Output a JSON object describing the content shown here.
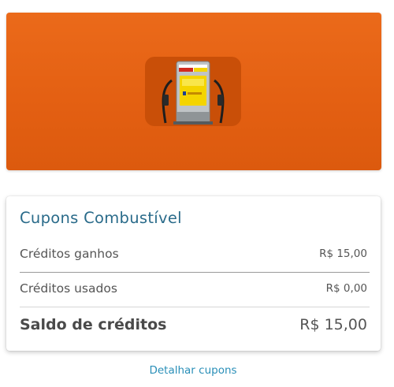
{
  "banner": {
    "icon": "fuel-pump-icon",
    "colors": {
      "accent": "#E8651A",
      "tile": "#C94F08",
      "pump_screen": "#F4D400"
    }
  },
  "coupons_card": {
    "title": "Cupons Combustível",
    "rows": [
      {
        "label": "Créditos ganhos",
        "value": "R$ 15,00"
      },
      {
        "label": "Créditos usados",
        "value": "R$ 0,00"
      }
    ],
    "total": {
      "label": "Saldo de créditos",
      "value": "R$ 15,00"
    }
  },
  "details_link": {
    "label": "Detalhar cupons",
    "color": "#2A8FB8"
  }
}
